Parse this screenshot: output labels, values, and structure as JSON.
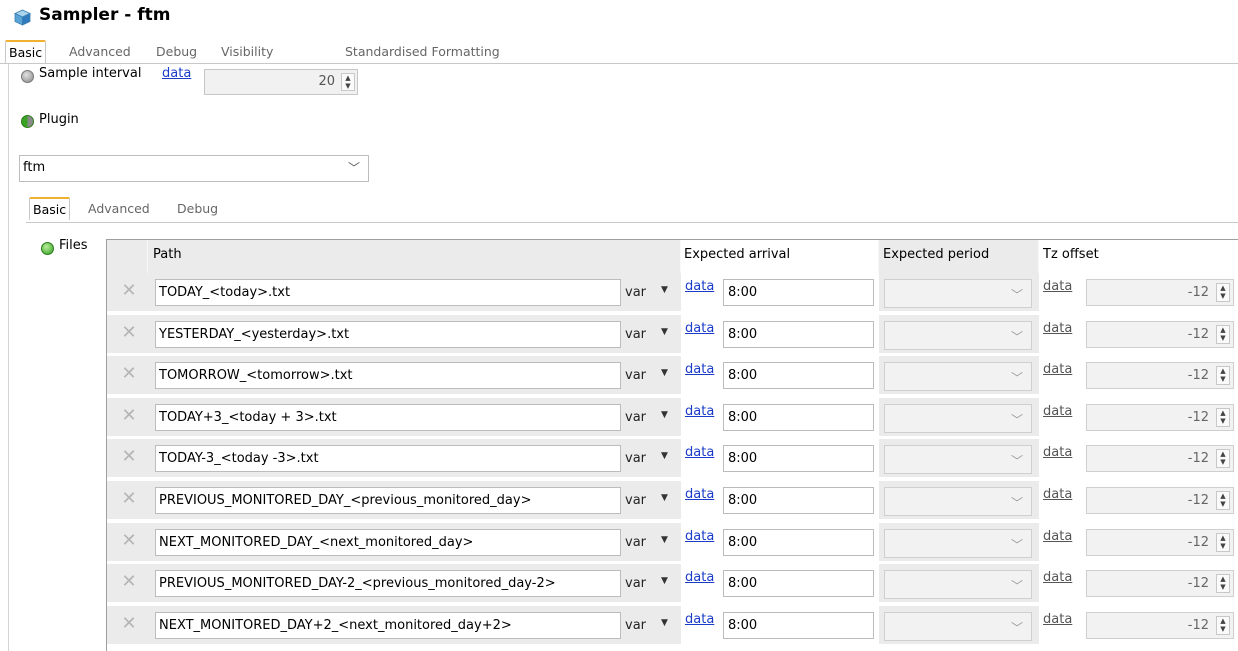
{
  "window": {
    "title": "Sampler - ftm"
  },
  "outer_tabs": [
    "Basic",
    "Advanced",
    "Debug",
    "Visibility",
    "Standardised Formatting"
  ],
  "sample_interval": {
    "label": "Sample interval",
    "link": "data",
    "value": "20"
  },
  "plugin": {
    "label": "Plugin",
    "selected": "ftm"
  },
  "inner_tabs": [
    "Basic",
    "Advanced",
    "Debug"
  ],
  "files": {
    "label": "Files",
    "columns": {
      "path": "Path",
      "expected_arrival": "Expected arrival",
      "expected_period": "Expected period",
      "tz_offset": "Tz offset"
    },
    "rows": [
      {
        "path": "TODAY_<today>.txt",
        "var": "var",
        "data": "data",
        "arrival": "8:00",
        "tz_data": "data",
        "tz": "-12"
      },
      {
        "path": "YESTERDAY_<yesterday>.txt",
        "var": "var",
        "data": "data",
        "arrival": "8:00",
        "tz_data": "data",
        "tz": "-12"
      },
      {
        "path": "TOMORROW_<tomorrow>.txt",
        "var": "var",
        "data": "data",
        "arrival": "8:00",
        "tz_data": "data",
        "tz": "-12"
      },
      {
        "path": "TODAY+3_<today + 3>.txt",
        "var": "var",
        "data": "data",
        "arrival": "8:00",
        "tz_data": "data",
        "tz": "-12"
      },
      {
        "path": "TODAY-3_<today -3>.txt",
        "var": "var",
        "data": "data",
        "arrival": "8:00",
        "tz_data": "data",
        "tz": "-12"
      },
      {
        "path": "PREVIOUS_MONITORED_DAY_<previous_monitored_day>",
        "var": "var",
        "data": "data",
        "arrival": "8:00",
        "tz_data": "data",
        "tz": "-12"
      },
      {
        "path": "NEXT_MONITORED_DAY_<next_monitored_day>",
        "var": "var",
        "data": "data",
        "arrival": "8:00",
        "tz_data": "data",
        "tz": "-12"
      },
      {
        "path": "PREVIOUS_MONITORED_DAY-2_<previous_monitored_day-2>",
        "var": "var",
        "data": "data",
        "arrival": "8:00",
        "tz_data": "data",
        "tz": "-12"
      },
      {
        "path": "NEXT_MONITORED_DAY+2_<next_monitored_day+2>",
        "var": "var",
        "data": "data",
        "arrival": "8:00",
        "tz_data": "data",
        "tz": "-12"
      }
    ]
  },
  "icons": {
    "title": "cube-icon",
    "delete": "delete-x-icon",
    "spinner": "spinner-arrows-icon",
    "dropdown": "chevron-down-icon"
  }
}
